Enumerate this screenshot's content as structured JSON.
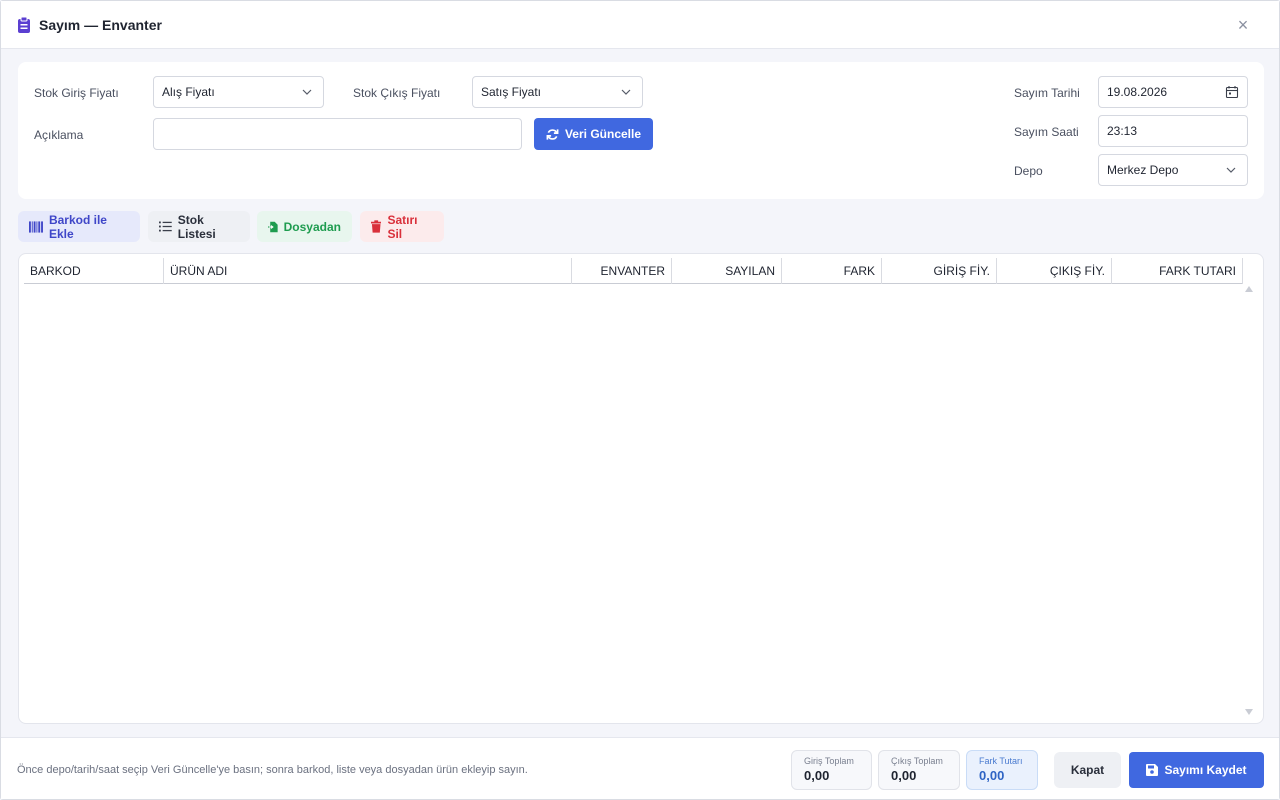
{
  "window": {
    "title": "Sayım — Envanter",
    "close_symbol": "×"
  },
  "form": {
    "stock_in_price_label": "Stok Giriş Fiyatı",
    "stock_in_price_value": "Alış Fiyatı",
    "stock_out_price_label": "Stok Çıkış Fiyatı",
    "stock_out_price_value": "Satış Fiyatı",
    "description_label": "Açıklama",
    "description_value": "",
    "refresh_button": "Veri Güncelle",
    "count_date_label": "Sayım Tarihi",
    "count_date_value": "19.08.2026",
    "count_time_label": "Sayım Saati",
    "count_time_value": "23:13",
    "warehouse_label": "Depo",
    "warehouse_value": "Merkez Depo"
  },
  "toolbar": {
    "barcode_add": "Barkod ile Ekle",
    "stock_list": "Stok Listesi",
    "from_file": "Dosyadan",
    "delete_row": "Satırı Sil"
  },
  "table": {
    "columns": [
      "BARKOD",
      "ÜRÜN ADI",
      "ENVANTER",
      "SAYILAN",
      "FARK",
      "GİRİŞ FİY.",
      "ÇIKIŞ FİY.",
      "FARK TUTARI"
    ],
    "rows": []
  },
  "footer": {
    "hint": "Önce depo/tarih/saat seçip Veri Güncelle'ye basın; sonra barkod, liste veya dosyadan ürün ekleyip sayın.",
    "in_total_label": "Giriş Toplam",
    "in_total_value": "0,00",
    "out_total_label": "Çıkış Toplam",
    "out_total_value": "0,00",
    "diff_total_label": "Fark Tutarı",
    "diff_total_value": "0,00",
    "close_button": "Kapat",
    "save_button": "Sayımı Kaydet"
  },
  "colors": {
    "primary": "#4068e0",
    "title_icon": "#5b3fd1",
    "barcode_btn": "#3f46c8",
    "file_btn": "#1e9c4f",
    "delete_btn": "#d9303b"
  }
}
